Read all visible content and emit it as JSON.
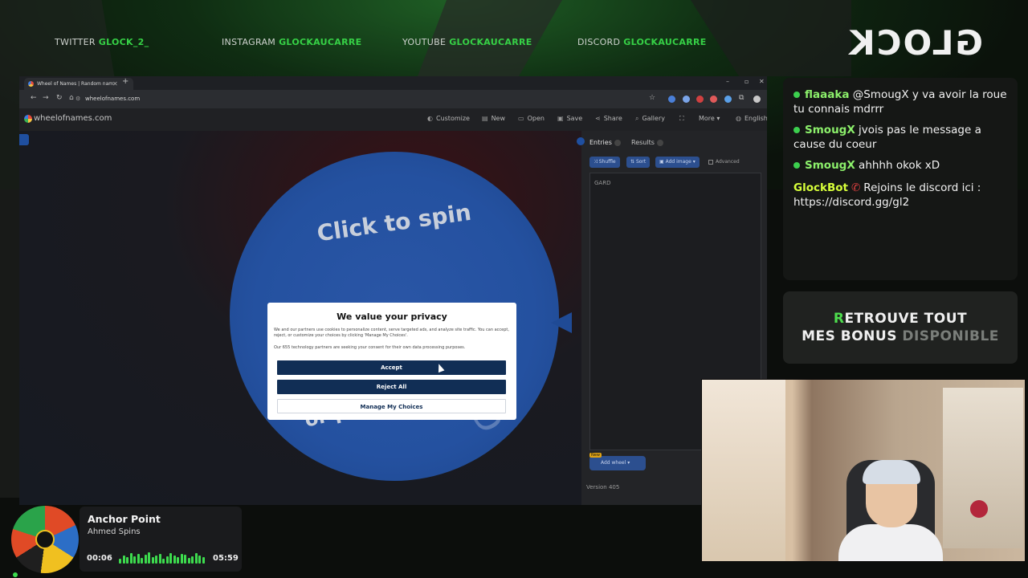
{
  "socials": [
    {
      "label": "TWITTER",
      "handle": "GLOCK_2_"
    },
    {
      "label": "INSTAGRAM",
      "handle": "GLOCKAUCARRE"
    },
    {
      "label": "YOUTUBE",
      "handle": "GLOCKAUCARRE"
    },
    {
      "label": "DISCORD",
      "handle": "GLOCKAUCARRE"
    }
  ],
  "logo_text": "GLOCK",
  "browser": {
    "tab_title": "Wheel of Names | Random nam",
    "url": "wheelofnames.com",
    "site_name": "wheelofnames.com",
    "menu": [
      "Customize",
      "New",
      "Open",
      "Save",
      "Share",
      "Gallery",
      "More",
      "English"
    ],
    "wheel": {
      "top_text": "Click to spin",
      "bottom_text": "or press ctrl+enter",
      "entry_text": "GARD"
    },
    "panel": {
      "tabs": [
        {
          "label": "Entries",
          "count": "1"
        },
        {
          "label": "Results",
          "count": "0"
        }
      ],
      "tools": [
        "Shuffle",
        "Sort",
        "Add image"
      ],
      "advanced_label": "Advanced",
      "entries_text": "GARD",
      "new_tag": "New",
      "add_wheel_label": "Add wheel",
      "version": "Version 405"
    },
    "privacy": {
      "title": "We value your privacy",
      "text": "We and our partners use cookies to personalize content, serve targeted ads, and analyze site traffic. You can accept, reject, or customize your choices by clicking 'Manage My Choices'.",
      "text2": "Our 655 technology partners are seeking your consent for their own data processing purposes.",
      "accept": "Accept",
      "reject": "Reject All",
      "manage": "Manage My Choices"
    }
  },
  "chat": [
    {
      "user": "flaaaka",
      "text": "@SmougX y va avoir la roue tu connais mdrrr"
    },
    {
      "user": "SmougX",
      "text": "jvois pas le message a cause du coeur"
    },
    {
      "user": "SmougX",
      "text": "ahhhh okok xD"
    },
    {
      "user": "GlockBot",
      "text": "Rejoins le discord ici : https://discord.gg/gl2"
    }
  ],
  "promo": {
    "line1_first": "R",
    "line1_rest": "ETROUVE TOUT",
    "line2_a": "MES ",
    "line2_b": "BONUS",
    "line2_c": " DISPONIBLE"
  },
  "music": {
    "title": "Anchor Point",
    "artist": "Ahmed Spins",
    "current": "00:06",
    "total": "05:59"
  },
  "colors": {
    "accent": "#36d146",
    "wheel": "#2451a0",
    "dialog_button": "#112e55"
  }
}
